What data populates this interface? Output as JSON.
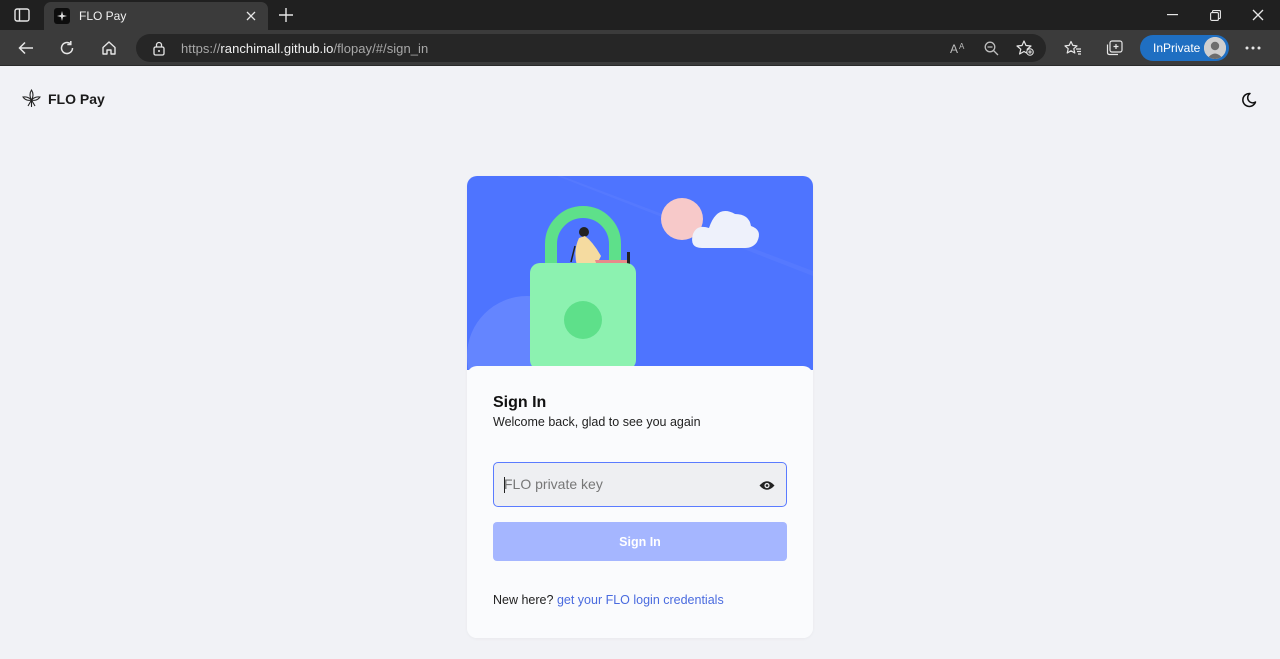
{
  "browser": {
    "tab_title": "FLO Pay",
    "url_prefix": "https://",
    "url_host": "ranchimall.github.io",
    "url_path": "/flopay/#/sign_in",
    "inprivate_label": "InPrivate",
    "icons": [
      "tab-actions-icon",
      "favicon-icon",
      "close-icon",
      "plus-icon",
      "minimize-icon",
      "restore-icon",
      "close-window-icon",
      "back-arrow-icon",
      "refresh-icon",
      "home-icon",
      "lock-icon",
      "read-aloud-icon",
      "zoom-out-icon",
      "add-favorite-icon",
      "favorites-icon",
      "collections-icon",
      "more-icon"
    ]
  },
  "app": {
    "name": "FLO Pay",
    "theme_icon": "moon-icon"
  },
  "signin": {
    "title": "Sign In",
    "subtitle": "Welcome back, glad to see you again",
    "input_placeholder": "FLO private key",
    "button_label": "Sign In",
    "footer_prefix": "New here?",
    "footer_link": "get your FLO login credentials"
  },
  "colors": {
    "accent": "#4e74ff",
    "button_disabled": "#a5b6ff",
    "lock": "#8cf2b0",
    "link": "#4a6bdf"
  }
}
